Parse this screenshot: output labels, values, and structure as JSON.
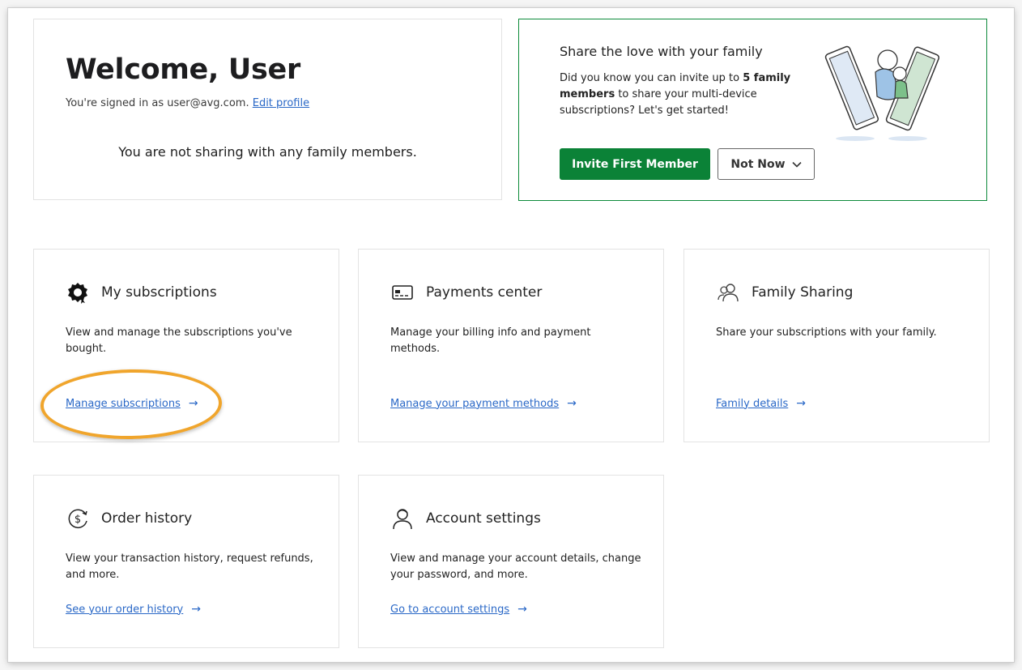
{
  "welcome": {
    "title": "Welcome, User",
    "signed_in_prefix": "You're signed in as user@avg.com.",
    "edit_profile": "Edit profile",
    "no_family": "You are not sharing with any family members."
  },
  "promo": {
    "title": "Share the love with your family",
    "text_a": "Did you know you can invite up to ",
    "text_bold": "5 family members",
    "text_b": " to share your multi-device subscriptions? Let's get started!",
    "invite_button": "Invite First Member",
    "not_now_button": "Not Now"
  },
  "tiles": [
    {
      "title": "My subscriptions",
      "desc": "View and manage the subscriptions you've bought.",
      "link": "Manage subscriptions",
      "icon": "gear-badge-icon"
    },
    {
      "title": "Payments center",
      "desc": "Manage your billing info and payment methods.",
      "link": "Manage your payment methods",
      "icon": "credit-card-icon"
    },
    {
      "title": "Family Sharing",
      "desc": "Share your subscriptions with your family.",
      "link": "Family details",
      "icon": "people-icon"
    },
    {
      "title": "Order history",
      "desc": "View your transaction history, request refunds, and more.",
      "link": "See your order history",
      "icon": "dollar-history-icon"
    },
    {
      "title": "Account settings",
      "desc": "View and manage your account details, change your password, and more.",
      "link": "Go to account settings",
      "icon": "user-icon"
    }
  ],
  "colors": {
    "accent_green": "#0b8237",
    "link_blue": "#2a68c7",
    "highlight_orange": "#f0a52c"
  }
}
